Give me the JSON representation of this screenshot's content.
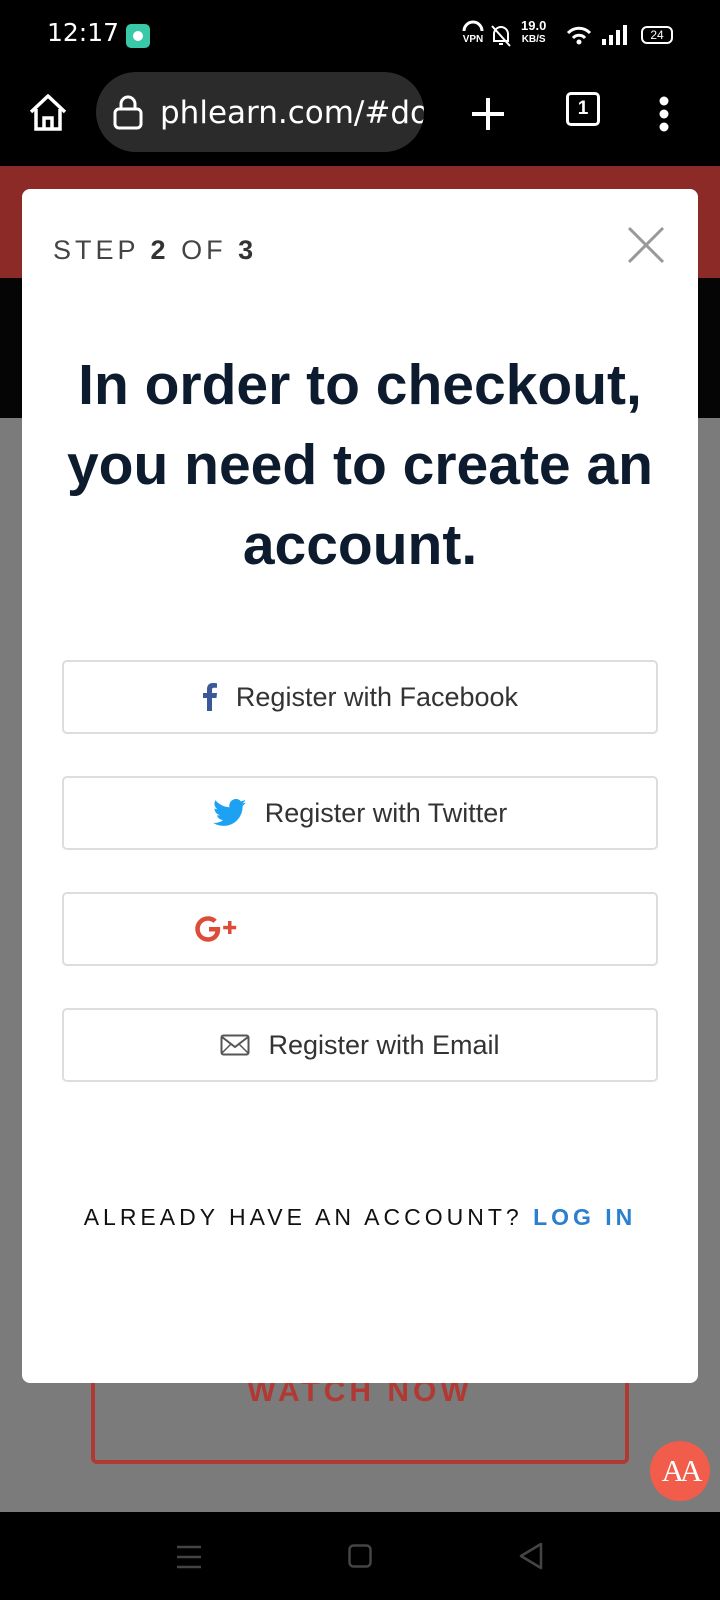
{
  "status_bar": {
    "time": "12:17",
    "vpn": "VPN",
    "speed_value": "19.0",
    "speed_unit": "KB/S",
    "battery": "24"
  },
  "browser": {
    "url": "phlearn.com/#do",
    "tab_count": "1"
  },
  "modal": {
    "step_prefix": "STEP",
    "step_current": "2",
    "step_of": "OF",
    "step_total": "3",
    "heading": "In order to checkout, you need to create an account.",
    "buttons": {
      "facebook": "Register with Facebook",
      "twitter": "Register with Twitter",
      "google": "",
      "email": "Register with Email"
    },
    "login_prompt": "ALREADY HAVE AN ACCOUNT?",
    "login_link": "LOG IN"
  },
  "page": {
    "watch_now": "WATCH NOW"
  },
  "fab_label": "AA",
  "colors": {
    "facebook": "#3b5998",
    "twitter": "#1da1f2",
    "google": "#dd4b39",
    "login_link": "#2a7fd0",
    "brand_red": "#b03a33"
  }
}
